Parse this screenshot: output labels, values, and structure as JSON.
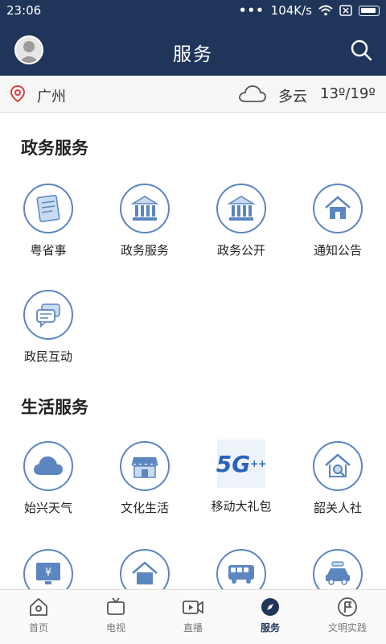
{
  "status": {
    "time": "23:06",
    "dots": "•••",
    "speed": "104K/s"
  },
  "header": {
    "title": "服务"
  },
  "weather": {
    "city": "广州",
    "condition": "多云",
    "temp": "13º/19º"
  },
  "gov": {
    "title": "政务服务",
    "items": [
      {
        "label": "粤省事",
        "icon": "document-icon"
      },
      {
        "label": "政务服务",
        "icon": "building-icon"
      },
      {
        "label": "政务公开",
        "icon": "building-icon"
      },
      {
        "label": "通知公告",
        "icon": "house-icon"
      },
      {
        "label": "政民互动",
        "icon": "chat-icon"
      }
    ]
  },
  "life": {
    "title": "生活服务",
    "items": [
      {
        "label": "始兴天气",
        "icon": "cloud-icon"
      },
      {
        "label": "文化生活",
        "icon": "shop-icon"
      },
      {
        "label": "移动大礼包",
        "icon": "5g-icon",
        "badge": "5G",
        "badge_plus": "++"
      },
      {
        "label": "韶关人社",
        "icon": "house-search-icon"
      }
    ],
    "partial_icons": [
      "monitor-yuan-icon",
      "house-icon",
      "bus-icon",
      "car-icon"
    ]
  },
  "tabs": [
    {
      "label": "首页",
      "icon": "home-icon"
    },
    {
      "label": "电视",
      "icon": "tv-icon"
    },
    {
      "label": "直播",
      "icon": "video-icon"
    },
    {
      "label": "服务",
      "icon": "compass-icon",
      "active": true
    },
    {
      "label": "文明实践",
      "icon": "flag-icon"
    }
  ],
  "colors": {
    "navy": "#1f3559",
    "icon_blue": "#5b86bf"
  }
}
